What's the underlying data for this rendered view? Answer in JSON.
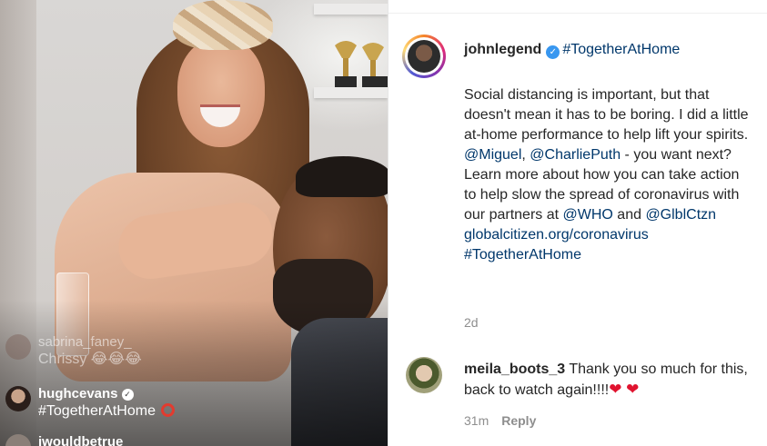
{
  "video": {
    "comments": [
      {
        "user": "sabrina_faney_",
        "text": "Chrissy 😂😂😂",
        "faded": true
      },
      {
        "user": "hughcevans",
        "text": "#TogetherAtHome",
        "faded": false
      },
      {
        "user": "iwouldbetrue",
        "text": "",
        "faded": false
      }
    ]
  },
  "post": {
    "username": "johnlegend",
    "hashtag": "#TogetherAtHome",
    "caption_parts": [
      {
        "text": "Social distancing is important, but that doesn't mean it has to be boring. I did a little at-home performance to help lift your spirits. ",
        "link": false
      },
      {
        "text": "@Miguel",
        "link": true
      },
      {
        "text": ", ",
        "link": false
      },
      {
        "text": "@CharliePuth",
        "link": true
      },
      {
        "text": " - you want next? Learn more about how you can take action to help slow the spread of coronavirus with our partners at ",
        "link": false
      },
      {
        "text": "@WHO",
        "link": true
      },
      {
        "text": " and ",
        "link": false
      },
      {
        "text": "@GlblCtzn",
        "link": true
      },
      {
        "text": " ",
        "link": false
      },
      {
        "text": "globalcitizen.org/coronavirus",
        "link": true
      },
      {
        "text": " ",
        "link": false
      },
      {
        "text": "#TogetherAtHome",
        "link": true
      }
    ],
    "time": "2d"
  },
  "comment": {
    "username": "meila_boots_3",
    "text": "Thank you so much for this, back to watch again!!!!",
    "hearts": "❤ ❤",
    "time": "31m",
    "reply": "Reply"
  },
  "colors": {
    "link": "#00376b",
    "verified": "#3897f0",
    "heart": "#e0132f"
  }
}
